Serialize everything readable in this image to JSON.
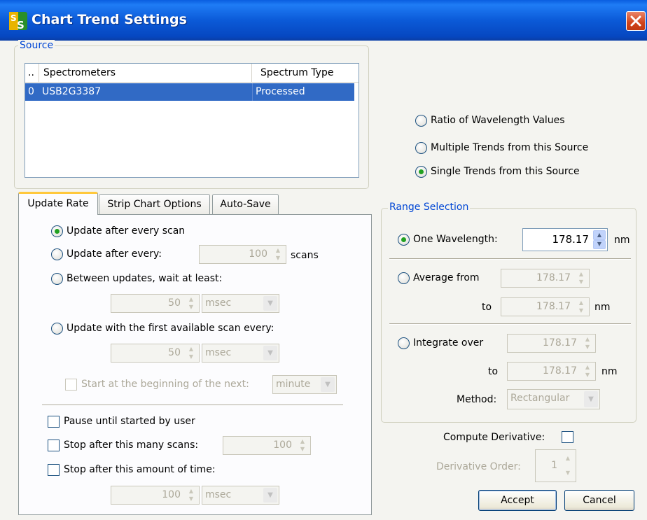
{
  "window": {
    "title": "Chart Trend Settings"
  },
  "source": {
    "legend": "Source",
    "columns": [
      "..",
      "Spectrometers",
      "Spectrum Type"
    ],
    "rows": [
      {
        "index": "0",
        "spectrometer": "USB2G3387",
        "type": "Processed"
      }
    ]
  },
  "modes": {
    "ratio": "Ratio of Wavelength Values",
    "multiple": "Multiple Trends from this Source",
    "single": "Single Trends from this Source"
  },
  "tabs": [
    "Update Rate",
    "Strip Chart Options",
    "Auto-Save"
  ],
  "update_rate": {
    "every_scan": "Update after every scan",
    "after_every": "Update after every:",
    "after_every_value": "100",
    "scans_unit": "scans",
    "between": "Between updates, wait at least:",
    "between_value": "50",
    "between_unit": "msec",
    "first_available": "Update with the first available scan every:",
    "first_available_value": "50",
    "first_available_unit": "msec",
    "start_next": "Start at the beginning of the next:",
    "start_next_unit": "minute",
    "pause": "Pause until started by user",
    "stop_scans": "Stop after this many scans:",
    "stop_scans_value": "100",
    "stop_time": "Stop after this amount of time:",
    "stop_time_value": "100",
    "stop_time_unit": "msec"
  },
  "range": {
    "legend": "Range Selection",
    "one": "One Wavelength:",
    "one_value": "178.17",
    "nm": "nm",
    "average": "Average from",
    "average_from": "178.17",
    "to": "to",
    "average_to": "178.17",
    "integrate": "Integrate over",
    "integrate_from": "178.17",
    "integrate_to": "178.17",
    "method_label": "Method:",
    "method_value": "Rectangular"
  },
  "derivative": {
    "compute": "Compute Derivative:",
    "order_label": "Derivative Order:",
    "order_value": "1"
  },
  "buttons": {
    "accept": "Accept",
    "cancel": "Cancel"
  },
  "colors": {
    "titlebar": "#0b5ad8",
    "selection": "#316ac5",
    "accent_tab": "#ffc83c",
    "radio_dot": "#21a121"
  }
}
